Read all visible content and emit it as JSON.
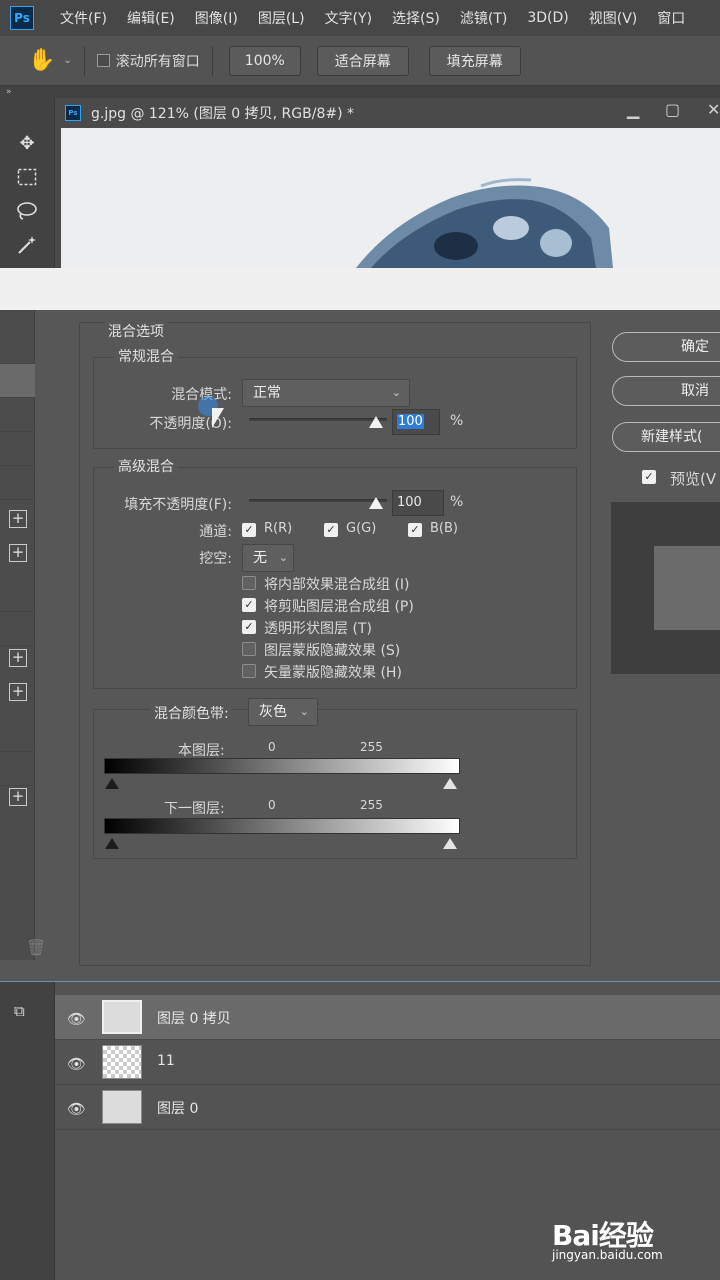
{
  "menu": {
    "app_logo": "Ps",
    "items": [
      "文件(F)",
      "编辑(E)",
      "图像(I)",
      "图层(L)",
      "文字(Y)",
      "选择(S)",
      "滤镜(T)",
      "3D(D)",
      "视图(V)",
      "窗口"
    ]
  },
  "options_bar": {
    "scroll_all_label": "滚动所有窗口",
    "zoom_value": "100%",
    "fit_screen": "适合屏幕",
    "fill_screen": "填充屏幕"
  },
  "panel_strip": {
    "collapse_glyph": "»"
  },
  "document": {
    "icon": "Ps",
    "title": "g.jpg @ 121% (图层 0 拷贝, RGB/8#) *"
  },
  "blending": {
    "title": "混合选项",
    "general": {
      "legend": "常规混合",
      "mode_label": "混合模式:",
      "mode_value": "正常",
      "opacity_label": "不透明度(O):",
      "opacity_value": "100",
      "percent": "%"
    },
    "advanced": {
      "legend": "高级混合",
      "fill_opacity_label": "填充不透明度(F):",
      "fill_opacity_value": "100",
      "percent": "%",
      "channels_label": "通道:",
      "channel_r": "R(R)",
      "channel_g": "G(G)",
      "channel_b": "B(B)",
      "knockout_label": "挖空:",
      "knockout_value": "无",
      "options": [
        {
          "label": "将内部效果混合成组 (I)",
          "checked": false
        },
        {
          "label": "将剪贴图层混合成组 (P)",
          "checked": true
        },
        {
          "label": "透明形状图层 (T)",
          "checked": true
        },
        {
          "label": "图层蒙版隐藏效果 (S)",
          "checked": false
        },
        {
          "label": "矢量蒙版隐藏效果 (H)",
          "checked": false
        }
      ]
    },
    "blend_if": {
      "label": "混合颜色带:",
      "value": "灰色",
      "this_layer_label": "本图层:",
      "underlying_label": "下一图层:",
      "min": "0",
      "max": "255"
    }
  },
  "dialog_buttons": {
    "ok": "确定",
    "cancel": "取消",
    "new_style": "新建样式(",
    "preview": "预览(V"
  },
  "layers": [
    {
      "name": "图层 0 拷贝",
      "selected": true
    },
    {
      "name": "11",
      "selected": false
    },
    {
      "name": "图层 0",
      "selected": false
    }
  ],
  "watermark": {
    "brand": "Bai经验",
    "url": "jingyan.baidu.com"
  }
}
